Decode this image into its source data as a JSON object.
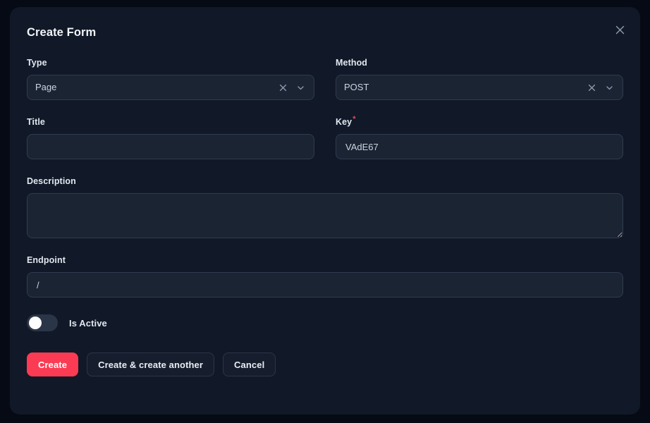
{
  "modal": {
    "title": "Create Form",
    "close_icon": "close-icon"
  },
  "fields": {
    "type": {
      "label": "Type",
      "value": "Page",
      "clear_icon": "clear-icon",
      "chevron_icon": "chevron-down-icon"
    },
    "method": {
      "label": "Method",
      "value": "POST",
      "clear_icon": "clear-icon",
      "chevron_icon": "chevron-down-icon"
    },
    "title_field": {
      "label": "Title",
      "value": "",
      "placeholder": ""
    },
    "key": {
      "label": "Key",
      "required_marker": "*",
      "value": "VAdE67",
      "placeholder": ""
    },
    "description": {
      "label": "Description",
      "value": "",
      "placeholder": ""
    },
    "endpoint": {
      "label": "Endpoint",
      "value": "/",
      "placeholder": ""
    },
    "is_active": {
      "label": "Is Active",
      "state": "off"
    }
  },
  "actions": {
    "create": "Create",
    "create_another": "Create & create another",
    "cancel": "Cancel"
  },
  "colors": {
    "page_background": "#060a14",
    "modal_background": "#111827",
    "field_background": "#1b2433",
    "field_border": "#2f3b4f",
    "primary": "#fb3b53",
    "required": "#e84a5f",
    "text": "#e2e8f0"
  }
}
